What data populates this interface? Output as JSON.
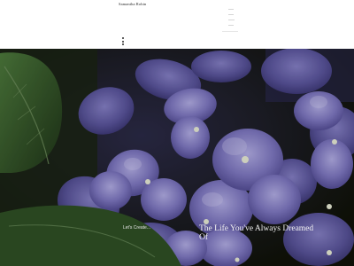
{
  "site": {
    "title": "Samantha Robin"
  },
  "hero": {
    "tagline": "Let's Create...",
    "headline": "The Life You've Always Dreamed Of"
  },
  "colors": {
    "background": "#ffffff",
    "title_text": "#2a2a2a",
    "hero_text": "#f2f2f2",
    "petal": "#7f78c2",
    "leaf": "#2c4a23"
  }
}
